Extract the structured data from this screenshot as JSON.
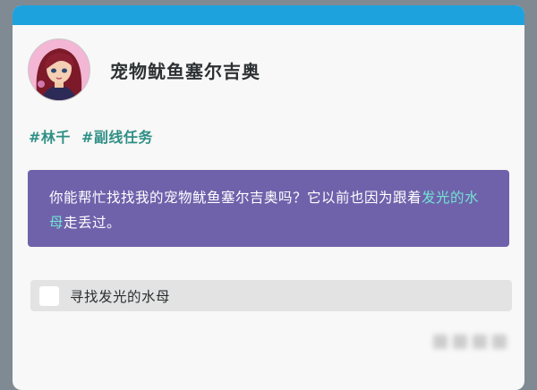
{
  "quest": {
    "title": "宠物鱿鱼塞尔吉奥",
    "tags": [
      "#林千",
      "#副线任务"
    ],
    "message": {
      "part1": "你能帮忙找找我的宠物鱿鱼塞尔吉奥吗？它以前也因为跟着",
      "highlight": "发光的水母",
      "part2": "走丢过。"
    },
    "tasks": [
      {
        "label": "寻找发光的水母",
        "checked": false
      }
    ]
  },
  "colors": {
    "top_bar": "#1ea2de",
    "message_bg": "#6f62ab",
    "tag_text": "#2f8f86",
    "highlight_text": "#72e3d3"
  }
}
